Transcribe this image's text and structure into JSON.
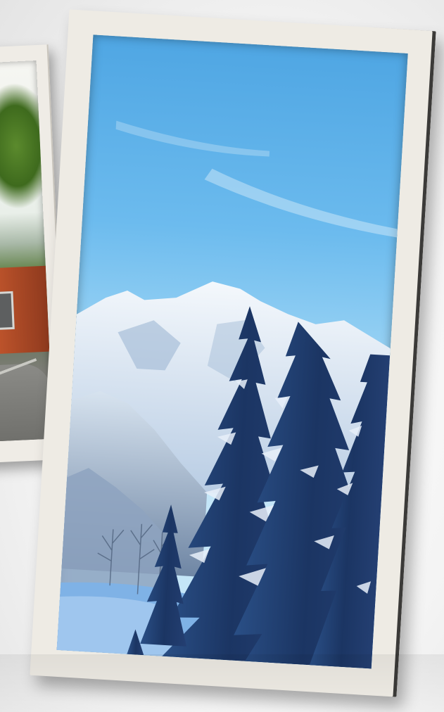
{
  "scene": {
    "back_photo_subject": "building-with-trees",
    "main_photo_subject": "snowy-mountain-pines",
    "colors": {
      "sky_top": "#4fa6e3",
      "sky_bottom": "#c4e6f8",
      "snow": "#eef4fb",
      "pine": "#1f3a66",
      "frame": "#eeebe4",
      "building": "#c0552c"
    }
  }
}
